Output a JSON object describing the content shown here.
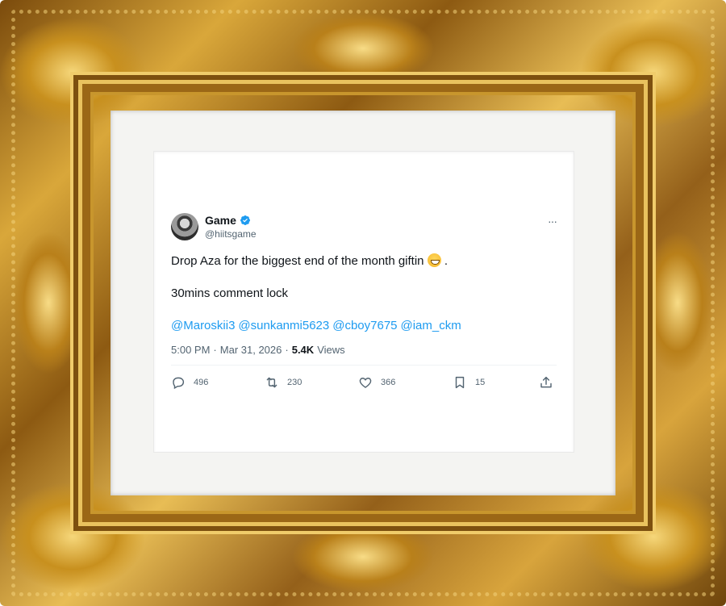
{
  "tweet": {
    "author": {
      "name": "Game",
      "handle": "@hiitsgame",
      "verified": true
    },
    "more_label": "···",
    "text_line1": "Drop Aza for the biggest end of the month giftin",
    "text_line1_suffix": ".",
    "emoji": "grinning-face-emoji",
    "text_line2": "30mins comment lock",
    "mentions": [
      "@Maroskii3",
      "@sunkanmi5623",
      "@cboy7675",
      "@iam_ckm"
    ],
    "time": "5:00 PM",
    "separator": "·",
    "date": "Mar 31, 2026",
    "views_count": "5.4K",
    "views_label": "Views",
    "actions": {
      "replies": "496",
      "reposts": "230",
      "likes": "366",
      "bookmarks": "15"
    }
  },
  "colors": {
    "link": "#1d9bf0",
    "muted": "#536471",
    "text": "#0f1419",
    "verified": "#1d9bf0",
    "frame_gold": "#c8901e"
  }
}
